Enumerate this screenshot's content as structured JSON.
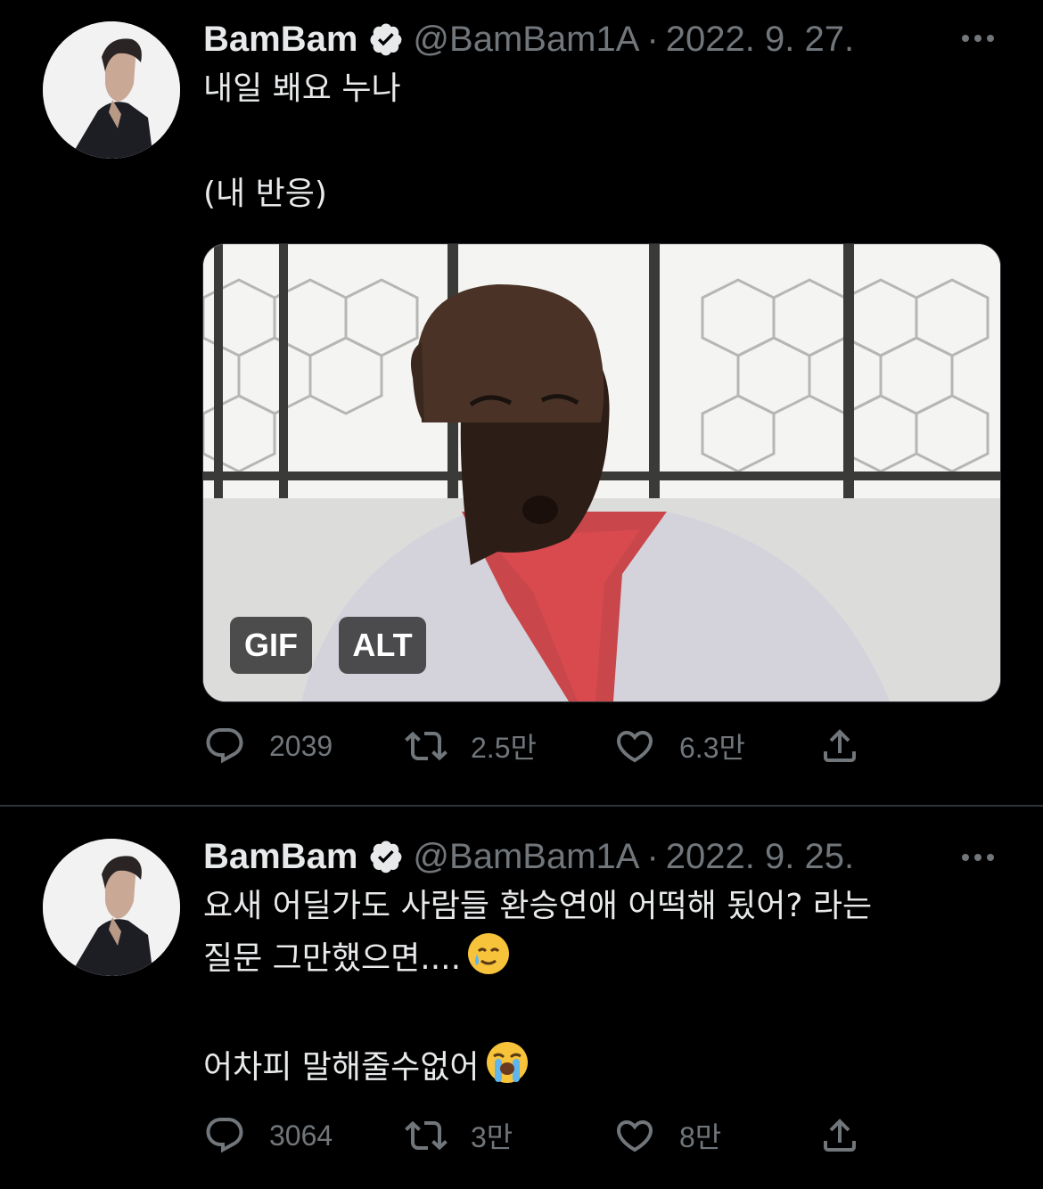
{
  "tweets": [
    {
      "author": {
        "name": "BamBam",
        "handle": "@BamBam1A",
        "verified": true
      },
      "date": "2022. 9. 27.",
      "text_lines": [
        "내일 봬요 누나",
        "(내 반응)"
      ],
      "media": {
        "type": "gif",
        "badges": [
          "GIF",
          "ALT"
        ]
      },
      "stats": {
        "replies": "2039",
        "retweets": "2.5만",
        "likes": "6.3만"
      }
    },
    {
      "author": {
        "name": "BamBam",
        "handle": "@BamBam1A",
        "verified": true
      },
      "date": "2022. 9. 25.",
      "text_lines": [
        "요새 어딜가도 사람들 환승연애 어떡해 됬어? 라는",
        "질문 그만했으면....",
        "어차피 말해줄수없어"
      ],
      "emojis": [
        "smiling-face-with-tear",
        "loudly-crying-face"
      ],
      "stats": {
        "replies": "3064",
        "retweets": "3만",
        "likes": "8만"
      }
    }
  ],
  "separator": "·",
  "colors": {
    "background": "#000000",
    "text": "#e7e9ea",
    "muted": "#71767b",
    "divider": "#2f3336"
  }
}
